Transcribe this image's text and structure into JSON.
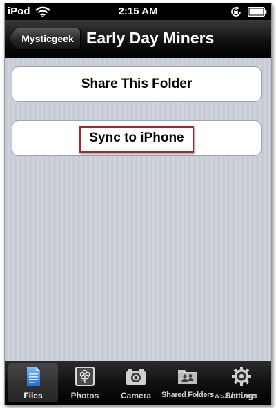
{
  "status_bar": {
    "carrier": "iPod",
    "time": "2:15 AM"
  },
  "nav_bar": {
    "back_label": "Mysticgeek",
    "title": "Early Day Miners"
  },
  "actions": {
    "share_label": "Share This Folder",
    "sync_label": "Sync to iPhone"
  },
  "tab_bar": {
    "selected": "Files",
    "tabs": [
      {
        "label": "Files",
        "icon": "document-icon"
      },
      {
        "label": "Photos",
        "icon": "flower-icon"
      },
      {
        "label": "Camera",
        "icon": "camera-icon"
      },
      {
        "label": "Shared Folders",
        "icon": "shared-folder-icon"
      },
      {
        "label": "Settings",
        "icon": "gear-icon"
      }
    ]
  },
  "watermark": "wsxdn.com",
  "colors": {
    "background": "#c8cdd6",
    "bars": "#000000",
    "highlight_border": "#9d2b2b",
    "active_tab_icon": "#3a8de0"
  }
}
